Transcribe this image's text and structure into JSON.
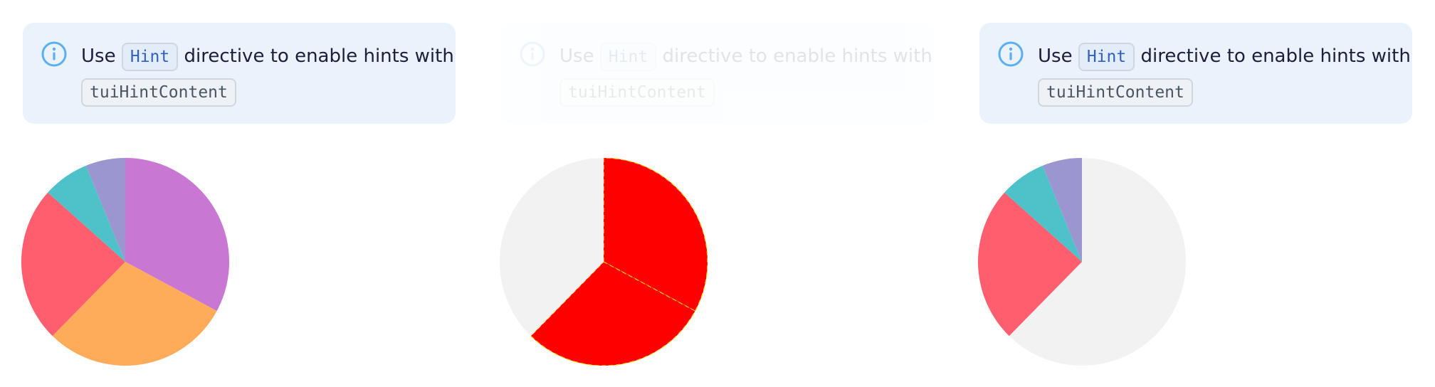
{
  "notification": {
    "pre": "Use",
    "code_hint": "Hint",
    "mid": "directive to enable hints with",
    "code_content": "tuiHintContent"
  },
  "colors": {
    "purple": "#c878d3",
    "orange": "#ffac5a",
    "red": "#ff5e6e",
    "teal": "#4fc1c8",
    "lavender": "#9b96d0",
    "gray": "#f2f2f2",
    "hover_red": "#ff0000",
    "info_icon": "#5aaef4"
  },
  "chart_data": [
    {
      "type": "pie",
      "values": [
        13769,
        12367,
        10172,
        3018,
        2592
      ],
      "colors": [
        "#c878d3",
        "#ffac5a",
        "#ff5e6e",
        "#4fc1c8",
        "#9b96d0"
      ]
    },
    {
      "type": "pie",
      "values": [
        13769,
        12367,
        10172,
        3018,
        2592
      ],
      "colors": [
        "#ff0000",
        "#ff0000",
        "#f2f2f2",
        "#f2f2f2",
        "#f2f2f2"
      ]
    },
    {
      "type": "pie",
      "values": [
        13769,
        12367,
        10172,
        3018,
        2592
      ],
      "colors": [
        "#f2f2f2",
        "#f2f2f2",
        "#ff5e6e",
        "#4fc1c8",
        "#9b96d0"
      ]
    }
  ]
}
